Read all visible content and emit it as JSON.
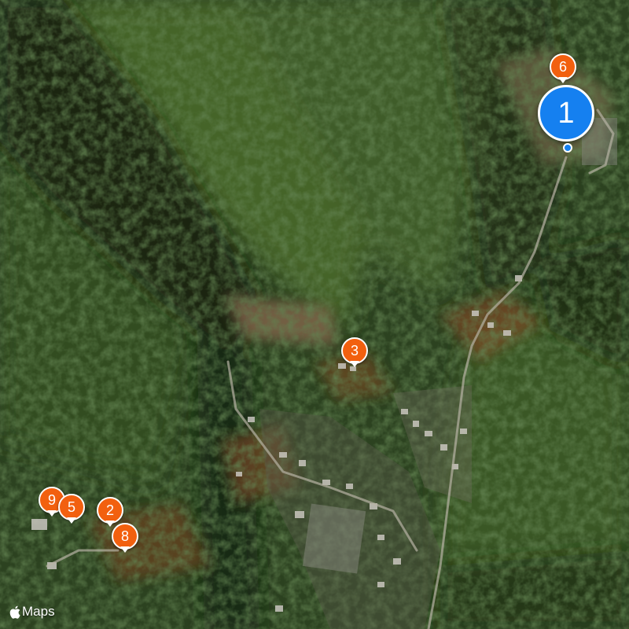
{
  "map": {
    "view": "satellite",
    "attribution": {
      "logo_icon": "apple-logo-icon",
      "label": "Maps"
    },
    "colors": {
      "forest_dark": "#1d2e16",
      "forest_mid": "#3a5226",
      "autumn": "#8a4a24",
      "pin_orange": "#f2600f",
      "pin_blue": "#1580f0"
    },
    "pins": [
      {
        "label": "1",
        "style": "blue",
        "selected": true
      },
      {
        "label": "6",
        "style": "orange"
      },
      {
        "label": "3",
        "style": "orange"
      },
      {
        "label": "2",
        "style": "orange"
      },
      {
        "label": "8",
        "style": "orange"
      },
      {
        "label": "9",
        "style": "orange"
      },
      {
        "label": "5",
        "style": "orange"
      }
    ]
  }
}
